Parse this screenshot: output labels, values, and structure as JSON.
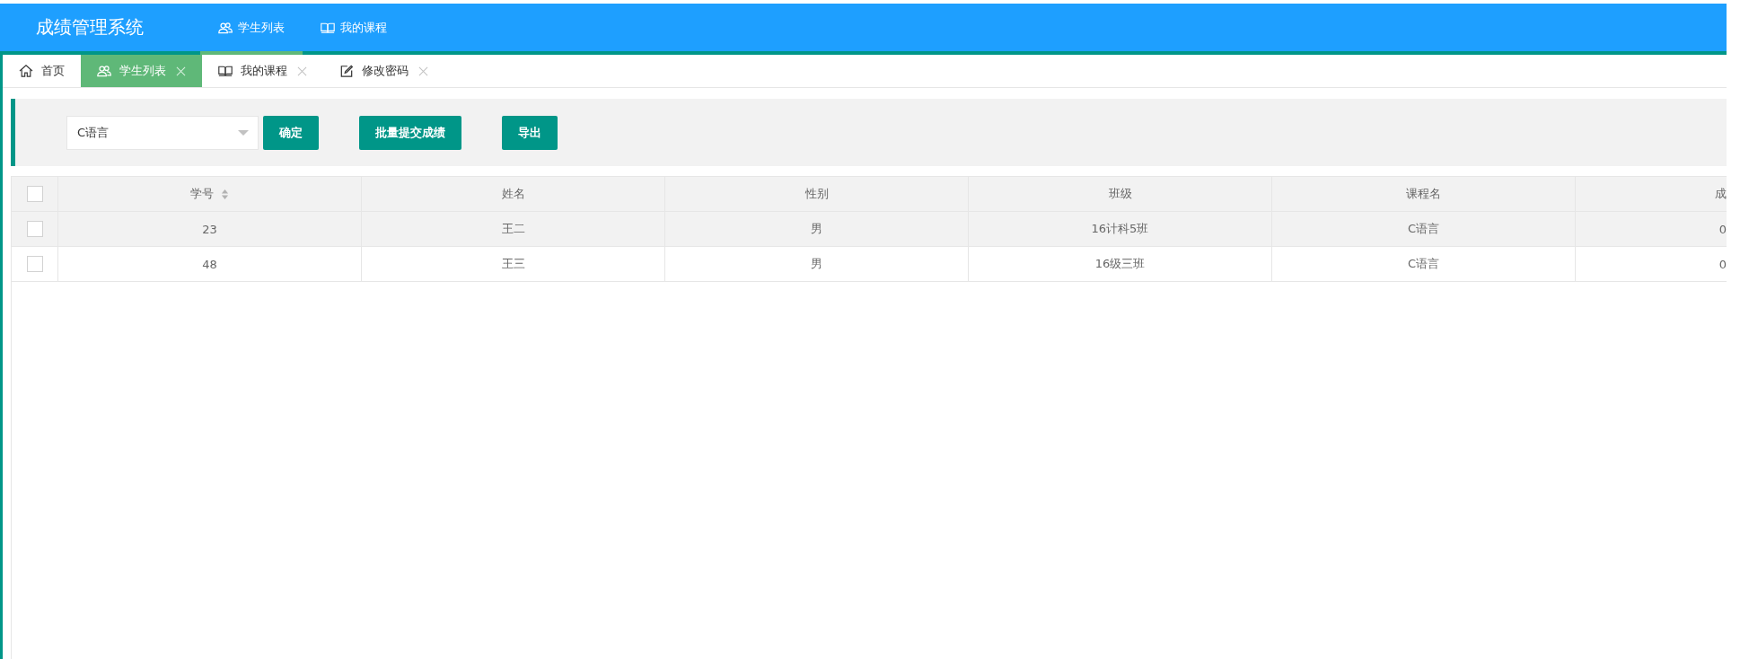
{
  "header": {
    "title": "成绩管理系统",
    "nav": [
      {
        "label": "学生列表",
        "selected": true
      },
      {
        "label": "我的课程",
        "selected": false
      }
    ]
  },
  "tabs": [
    {
      "label": "首页",
      "closable": false,
      "selected": false
    },
    {
      "label": "学生列表",
      "closable": true,
      "selected": true
    },
    {
      "label": "我的课程",
      "closable": true,
      "selected": false
    },
    {
      "label": "修改密码",
      "closable": true,
      "selected": false
    }
  ],
  "toolbar": {
    "course_select": {
      "value": "C语言"
    },
    "buttons": [
      "确定",
      "批量提交成绩",
      "导出"
    ]
  },
  "table": {
    "select_all_checked": false,
    "columns": [
      {
        "label": "学号",
        "sortable": true
      },
      {
        "label": "姓名",
        "sortable": false
      },
      {
        "label": "性别",
        "sortable": false
      },
      {
        "label": "班级",
        "sortable": false
      },
      {
        "label": "课程名",
        "sortable": false
      },
      {
        "label": "成",
        "sortable": false
      }
    ],
    "rows": [
      {
        "checked": false,
        "highlighted": true,
        "cells": [
          "23",
          "王二",
          "男",
          "16计科5班",
          "C语言",
          "0"
        ]
      },
      {
        "checked": false,
        "highlighted": false,
        "cells": [
          "48",
          "王三",
          "男",
          "16级三班",
          "C语言",
          "0"
        ]
      }
    ]
  }
}
